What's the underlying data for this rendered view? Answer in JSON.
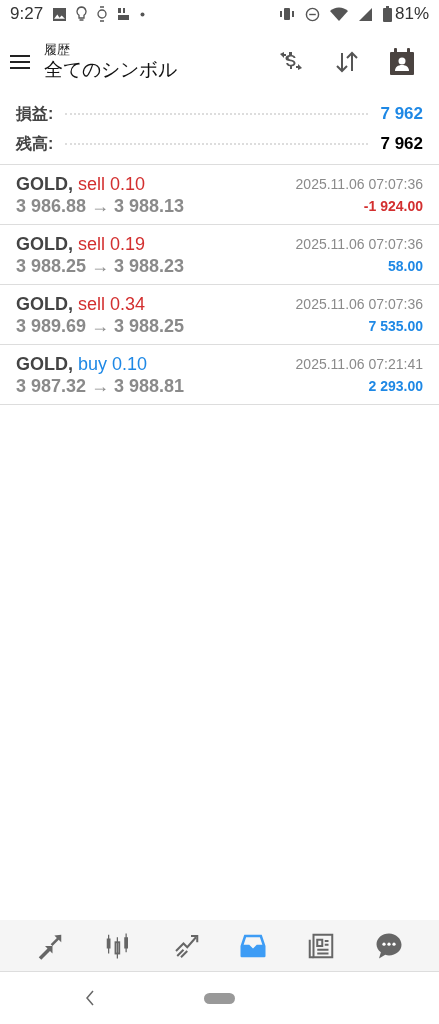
{
  "status_bar": {
    "time": "9:27",
    "battery": "81%"
  },
  "header": {
    "subtitle": "履歴",
    "title": "全てのシンボル"
  },
  "summary": [
    {
      "label": "損益:",
      "value": "7 962",
      "kind": "profit"
    },
    {
      "label": "残高:",
      "value": "7 962",
      "kind": "balance"
    }
  ],
  "deals": [
    {
      "symbol": "GOLD,",
      "side": "sell 0.10",
      "kind": "sell",
      "prices": "3 986.88 → 3 988.13",
      "time": "2025.11.06 07:07:36",
      "profit": "-1 924.00",
      "loss": true
    },
    {
      "symbol": "GOLD,",
      "side": "sell 0.19",
      "kind": "sell",
      "prices": "3 988.25 → 3 988.23",
      "time": "2025.11.06 07:07:36",
      "profit": "58.00",
      "loss": false
    },
    {
      "symbol": "GOLD,",
      "side": "sell 0.34",
      "kind": "sell",
      "prices": "3 989.69 → 3 988.25",
      "time": "2025.11.06 07:07:36",
      "profit": "7 535.00",
      "loss": false
    },
    {
      "symbol": "GOLD,",
      "side": "buy 0.10",
      "kind": "buy",
      "prices": "3 987.32 → 3 988.81",
      "time": "2025.11.06 07:21:41",
      "profit": "2 293.00",
      "loss": false
    }
  ],
  "bottom_nav": [
    {
      "kind": "quotes",
      "selected": false
    },
    {
      "kind": "chart",
      "selected": false
    },
    {
      "kind": "trade",
      "selected": false
    },
    {
      "kind": "history",
      "selected": true
    },
    {
      "kind": "news",
      "selected": false
    },
    {
      "kind": "chat",
      "selected": false
    }
  ]
}
